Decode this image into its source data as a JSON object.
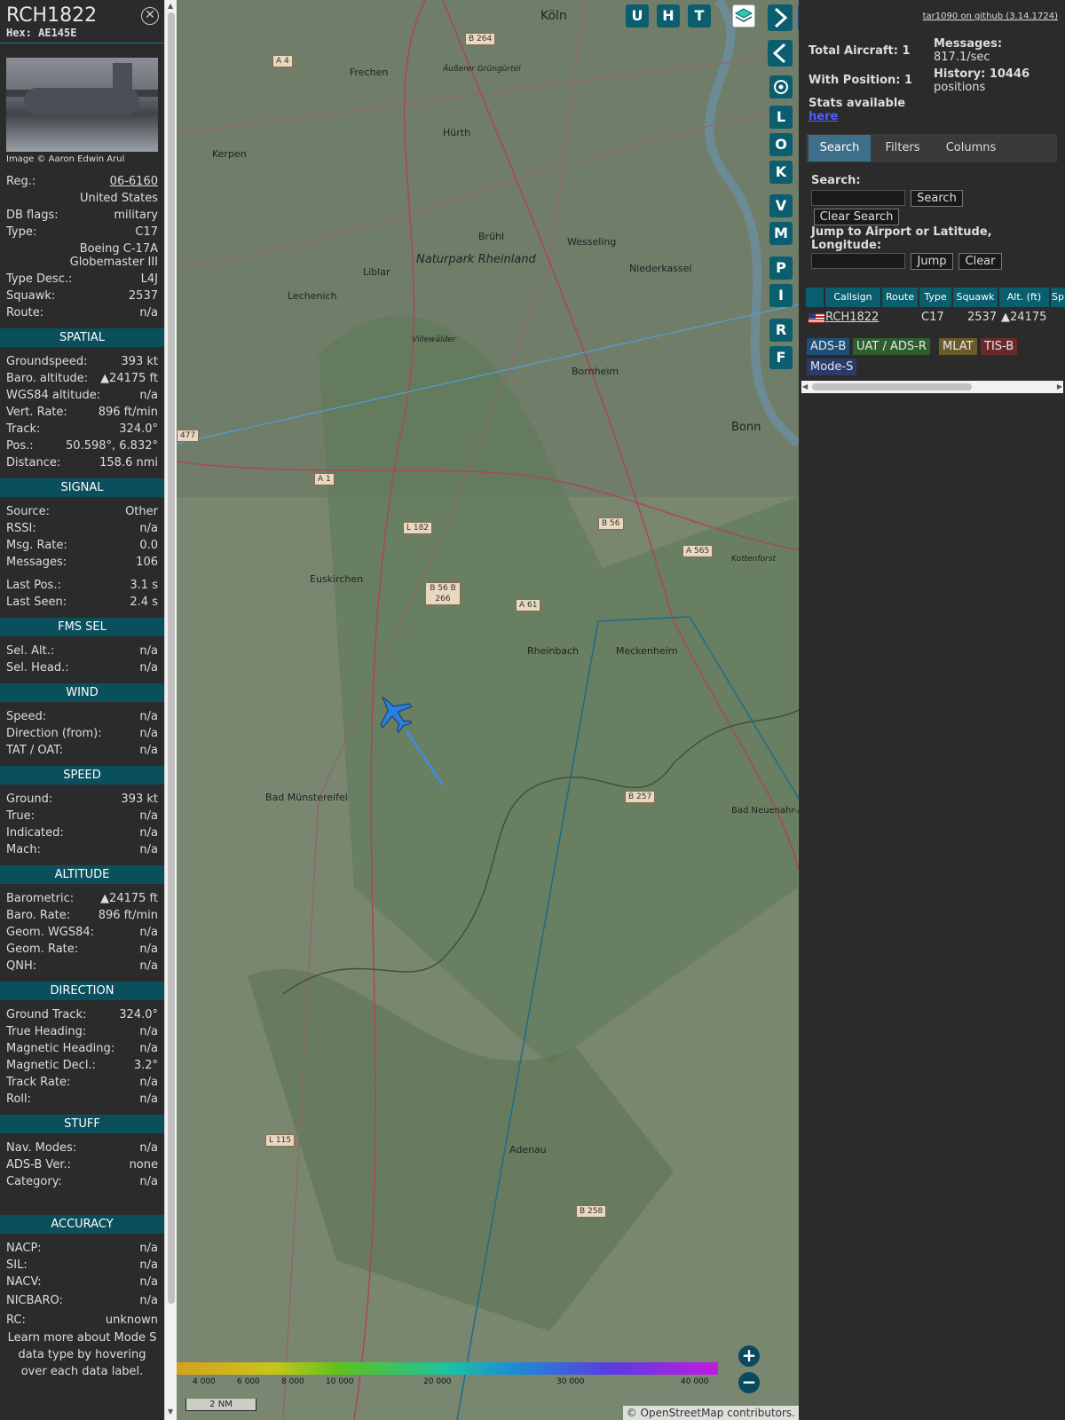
{
  "detail": {
    "callsign": "RCH1822",
    "hex": "Hex: AE145E",
    "image_credit": "Image © Aaron Edwin Arul",
    "info": [
      {
        "label": "Reg.:",
        "value": "06-6160",
        "link": true
      },
      {
        "label": "",
        "value": "United States"
      },
      {
        "label": "DB flags:",
        "value": "military"
      },
      {
        "label": "Type:",
        "value": "C17"
      },
      {
        "label": "",
        "value": "Boeing C-17A Globemaster III",
        "tall": true
      },
      {
        "label": "Type Desc.:",
        "value": "L4J"
      },
      {
        "label": "Squawk:",
        "value": "2537"
      },
      {
        "label": "Route:",
        "value": "n/a"
      }
    ],
    "sections": [
      {
        "title": "SPATIAL",
        "rows": [
          {
            "label": "Groundspeed:",
            "value": "393 kt"
          },
          {
            "label": "Baro. altitude:",
            "value": "▲24175 ft"
          },
          {
            "label": "WGS84 altitude:",
            "value": "n/a"
          },
          {
            "label": "Vert. Rate:",
            "value": "896 ft/min"
          },
          {
            "label": "Track:",
            "value": "324.0°"
          },
          {
            "label": "Pos.:",
            "value": "50.598°, 6.832°"
          },
          {
            "label": "Distance:",
            "value": "158.6 nmi"
          }
        ]
      },
      {
        "title": "SIGNAL",
        "rows": [
          {
            "label": "Source:",
            "value": "Other"
          },
          {
            "label": "RSSI:",
            "value": "n/a"
          },
          {
            "label": "Msg. Rate:",
            "value": "0.0"
          },
          {
            "label": "Messages:",
            "value": "106"
          },
          {
            "gap": true
          },
          {
            "label": "Last Pos.:",
            "value": "3.1 s"
          },
          {
            "label": "Last Seen:",
            "value": "2.4 s"
          }
        ]
      },
      {
        "title": "FMS SEL",
        "rows": [
          {
            "label": "Sel. Alt.:",
            "value": "n/a"
          },
          {
            "label": "Sel. Head.:",
            "value": "n/a"
          }
        ]
      },
      {
        "title": "WIND",
        "rows": [
          {
            "label": "Speed:",
            "value": "n/a"
          },
          {
            "label": "Direction (from):",
            "value": "n/a"
          },
          {
            "label": "TAT / OAT:",
            "value": "n/a"
          }
        ]
      },
      {
        "title": "SPEED",
        "rows": [
          {
            "label": "Ground:",
            "value": "393 kt"
          },
          {
            "label": "True:",
            "value": "n/a"
          },
          {
            "label": "Indicated:",
            "value": "n/a"
          },
          {
            "label": "Mach:",
            "value": "n/a"
          }
        ]
      },
      {
        "title": "ALTITUDE",
        "rows": [
          {
            "label": "Barometric:",
            "value": "▲24175 ft"
          },
          {
            "label": "Baro. Rate:",
            "value": "896 ft/min"
          },
          {
            "label": "Geom. WGS84:",
            "value": "n/a"
          },
          {
            "label": "Geom. Rate:",
            "value": "n/a"
          },
          {
            "label": "QNH:",
            "value": "n/a"
          }
        ]
      },
      {
        "title": "DIRECTION",
        "rows": [
          {
            "label": "Ground Track:",
            "value": "324.0°"
          },
          {
            "label": "True Heading:",
            "value": "n/a"
          },
          {
            "label": "Magnetic Heading:",
            "value": "n/a"
          },
          {
            "label": "Magnetic Decl.:",
            "value": "3.2°"
          },
          {
            "label": "Track Rate:",
            "value": "n/a"
          },
          {
            "label": "Roll:",
            "value": "n/a"
          }
        ]
      },
      {
        "title": "STUFF",
        "rows": [
          {
            "label": "Nav. Modes:",
            "value": "n/a"
          },
          {
            "label": "ADS-B Ver.:",
            "value": "none"
          },
          {
            "label": "Category:",
            "value": "n/a"
          }
        ]
      },
      {
        "title": "ACCURACY",
        "spaced": true,
        "rows": [
          {
            "label": "NACP:",
            "value": "n/a"
          },
          {
            "label": "SIL:",
            "value": "n/a"
          },
          {
            "label": "NACV:",
            "value": "n/a"
          },
          {
            "label": "NICBARO:",
            "value": "n/a"
          },
          {
            "label": "RC:",
            "value": "unknown"
          }
        ]
      }
    ],
    "footnote": "Learn more about Mode S data type by hovering over each data label."
  },
  "map": {
    "top_buttons": [
      "U",
      "H",
      "T"
    ],
    "side_buttons": [
      "L",
      "O",
      "K",
      "V",
      "M",
      "P",
      "I",
      "R",
      "F"
    ],
    "scale_label": "2 NM",
    "altitude_ticks": [
      "4 000",
      "6 000",
      "8 000",
      "10 000",
      "20 000",
      "30 000",
      "40 000"
    ],
    "attribution": "© OpenStreetMap contributors.",
    "place_labels": [
      "Köln",
      "Frechen",
      "Hürth",
      "Brühl",
      "Wesseling",
      "Niederkassel",
      "Kerpen",
      "Lechenich",
      "Liblar",
      "Naturpark Rheinland",
      "Bornheim",
      "Bonn",
      "Euskirchen",
      "Rheinbach",
      "Meckenheim",
      "Bad Münstereifel",
      "Bad Neuenahr-Ahrweiler",
      "Adenau",
      "Kottenforst",
      "Villewälder",
      "Äußerer Grüngürtel"
    ],
    "road_labels": [
      "A 4",
      "B 264",
      "A 1",
      "L 182",
      "B 56",
      "B 56 B 266",
      "A 61",
      "A 565",
      "B 257",
      "L 115",
      "B 258",
      "477"
    ]
  },
  "panel": {
    "version_link": "tar1090 on github (3.14.1724)",
    "total_aircraft": "Total Aircraft: 1",
    "with_position": "With Position: 1",
    "stats_text": "Stats available",
    "stats_link": "here",
    "messages_label": "Messages:",
    "messages_value": "817.1/sec",
    "history_label": "History: 10446",
    "history_value": "positions",
    "tabs": [
      "Search",
      "Filters",
      "Columns"
    ],
    "search_label": "Search:",
    "search_button": "Search",
    "clear_search_button": "Clear Search",
    "jump_label": "Jump to Airport or Latitude, Longitude:",
    "jump_button": "Jump",
    "clear_button": "Clear",
    "table_headers": [
      "Callsign",
      "Route",
      "Type",
      "Squawk",
      "Alt. (ft)",
      "Sp"
    ],
    "table_rows": [
      {
        "callsign": "RCH1822",
        "route": "",
        "type": "C17",
        "squawk": "2537",
        "alt": "▲24175"
      }
    ],
    "source_chips": [
      {
        "label": "ADS-B",
        "color": "#1f4e79"
      },
      {
        "label": "UAT / ADS-R",
        "color": "#2e5e2e"
      },
      {
        "label": "MLAT",
        "color": "#6b5a2a"
      },
      {
        "label": "TIS-B",
        "color": "#6b2a2a"
      },
      {
        "label": "Mode-S",
        "color": "#2a3a6b"
      }
    ]
  }
}
